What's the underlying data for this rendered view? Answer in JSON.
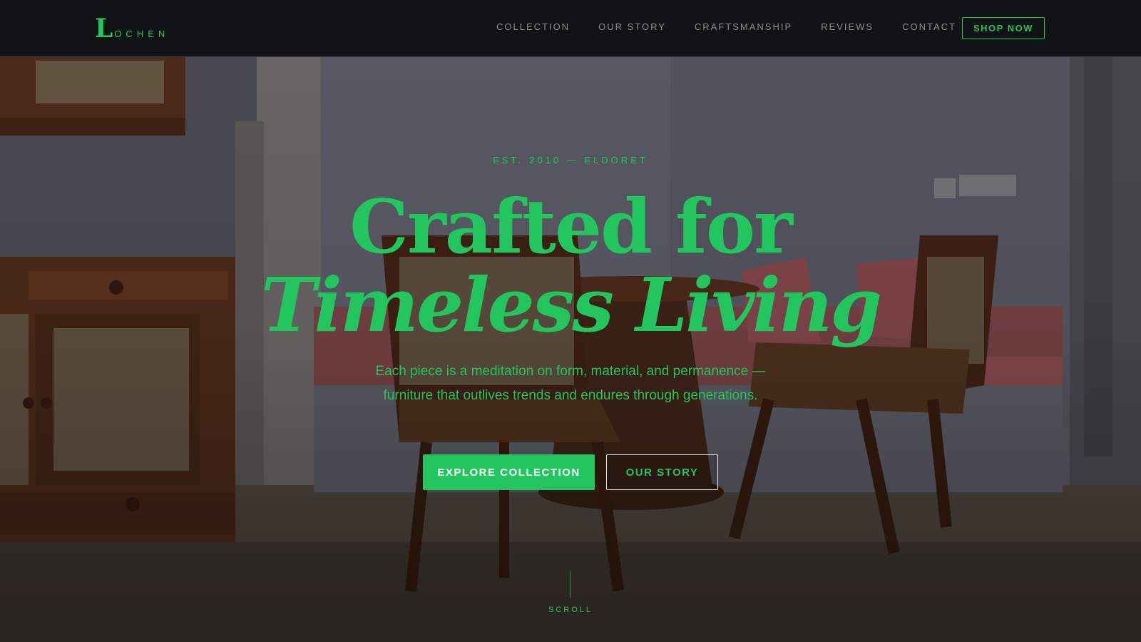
{
  "navbar": {
    "logo_initial": "L",
    "logo_rest": "ochen",
    "links": [
      {
        "label": "COLLECTION"
      },
      {
        "label": "OUR STORY"
      },
      {
        "label": "CRAFTSMANSHIP"
      },
      {
        "label": "REVIEWS"
      },
      {
        "label": "CONTACT"
      }
    ],
    "cta_label": "SHOP NOW"
  },
  "hero": {
    "eyebrow": "EST. 2010 — ELDORET",
    "headline_line1": "Crafted for",
    "headline_line2": "Timeless Living",
    "subtext": "Each piece is a meditation on form, material, and permanence — furniture that outlives trends and endures through generations.",
    "primary_button": "EXPLORE COLLECTION",
    "secondary_button": "OUR STORY",
    "scroll_label": "SCROLL"
  },
  "colors": {
    "accent": "#22c55e",
    "navbar_bg": "#111213",
    "nav_link": "#8a8f8c"
  }
}
